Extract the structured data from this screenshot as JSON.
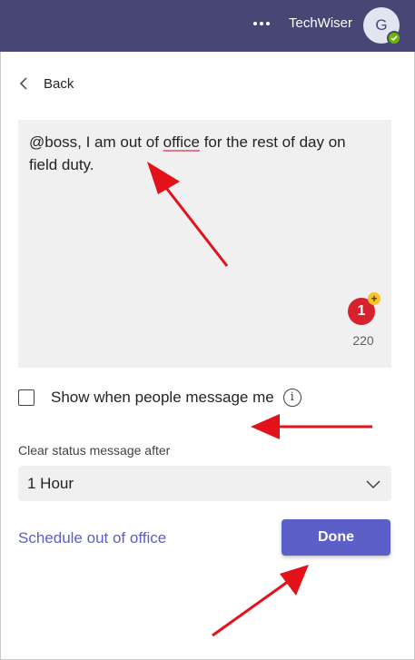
{
  "header": {
    "org_name": "TechWiser",
    "avatar_initial": "G",
    "more_icon": "more-horizontal-icon",
    "presence_status": "available",
    "bg_color": "#464775"
  },
  "nav": {
    "back_label": "Back"
  },
  "status_message": {
    "text_before": "@boss, I am out of ",
    "text_misspelled": "office",
    "text_after": " for the rest of day on field duty.",
    "emoji_badge": "1",
    "char_remaining": "220"
  },
  "show_when_message": {
    "label": "Show when people message me",
    "checked": false
  },
  "clear_after": {
    "label": "Clear status message after",
    "selected": "1 Hour"
  },
  "footer": {
    "schedule_link": "Schedule out of office",
    "done_label": "Done"
  },
  "colors": {
    "accent": "#5b5fc7",
    "annotation_arrow": "#e3111a"
  }
}
